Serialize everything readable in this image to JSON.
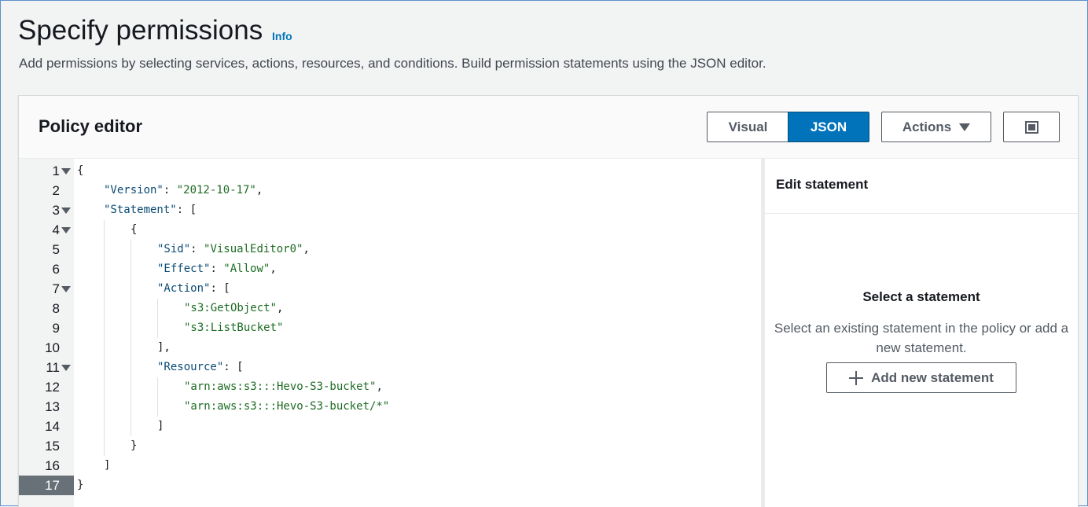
{
  "header": {
    "title": "Specify permissions",
    "info_label": "Info",
    "description": "Add permissions by selecting services, actions, resources, and conditions. Build permission statements using the JSON editor."
  },
  "policy_editor": {
    "title": "Policy editor",
    "mode_visual": "Visual",
    "mode_json": "JSON",
    "selected_mode": "JSON",
    "actions_label": "Actions",
    "icons": {
      "actions": "caret-down-icon",
      "fullscreen": "fullscreen-icon",
      "fold": "fold-triangle-icon"
    }
  },
  "editor": {
    "active_line": 17,
    "lines": [
      {
        "n": "1",
        "fold": true,
        "indent": 0,
        "tokens": [
          {
            "t": "p",
            "v": "{"
          }
        ]
      },
      {
        "n": "2",
        "fold": false,
        "indent": 1,
        "tokens": [
          {
            "t": "key",
            "v": "\"Version\""
          },
          {
            "t": "p",
            "v": ": "
          },
          {
            "t": "str",
            "v": "\"2012-10-17\""
          },
          {
            "t": "p",
            "v": ","
          }
        ]
      },
      {
        "n": "3",
        "fold": true,
        "indent": 1,
        "tokens": [
          {
            "t": "key",
            "v": "\"Statement\""
          },
          {
            "t": "p",
            "v": ": ["
          }
        ]
      },
      {
        "n": "4",
        "fold": true,
        "indent": 2,
        "tokens": [
          {
            "t": "p",
            "v": "{"
          }
        ]
      },
      {
        "n": "5",
        "fold": false,
        "indent": 3,
        "tokens": [
          {
            "t": "key",
            "v": "\"Sid\""
          },
          {
            "t": "p",
            "v": ": "
          },
          {
            "t": "str",
            "v": "\"VisualEditor0\""
          },
          {
            "t": "p",
            "v": ","
          }
        ]
      },
      {
        "n": "6",
        "fold": false,
        "indent": 3,
        "tokens": [
          {
            "t": "key",
            "v": "\"Effect\""
          },
          {
            "t": "p",
            "v": ": "
          },
          {
            "t": "str",
            "v": "\"Allow\""
          },
          {
            "t": "p",
            "v": ","
          }
        ]
      },
      {
        "n": "7",
        "fold": true,
        "indent": 3,
        "tokens": [
          {
            "t": "key",
            "v": "\"Action\""
          },
          {
            "t": "p",
            "v": ": ["
          }
        ]
      },
      {
        "n": "8",
        "fold": false,
        "indent": 4,
        "tokens": [
          {
            "t": "str",
            "v": "\"s3:GetObject\""
          },
          {
            "t": "p",
            "v": ","
          }
        ]
      },
      {
        "n": "9",
        "fold": false,
        "indent": 4,
        "tokens": [
          {
            "t": "str",
            "v": "\"s3:ListBucket\""
          }
        ]
      },
      {
        "n": "10",
        "fold": false,
        "indent": 3,
        "tokens": [
          {
            "t": "p",
            "v": "],"
          }
        ]
      },
      {
        "n": "11",
        "fold": true,
        "indent": 3,
        "tokens": [
          {
            "t": "key",
            "v": "\"Resource\""
          },
          {
            "t": "p",
            "v": ": ["
          }
        ]
      },
      {
        "n": "12",
        "fold": false,
        "indent": 4,
        "tokens": [
          {
            "t": "str",
            "v": "\"arn:aws:s3:::Hevo-S3-bucket\""
          },
          {
            "t": "p",
            "v": ","
          }
        ]
      },
      {
        "n": "13",
        "fold": false,
        "indent": 4,
        "tokens": [
          {
            "t": "str",
            "v": "\"arn:aws:s3:::Hevo-S3-bucket/*\""
          }
        ]
      },
      {
        "n": "14",
        "fold": false,
        "indent": 3,
        "tokens": [
          {
            "t": "p",
            "v": "]"
          }
        ]
      },
      {
        "n": "15",
        "fold": false,
        "indent": 2,
        "tokens": [
          {
            "t": "p",
            "v": "}"
          }
        ]
      },
      {
        "n": "16",
        "fold": false,
        "indent": 1,
        "tokens": [
          {
            "t": "p",
            "v": "]"
          }
        ]
      },
      {
        "n": "17",
        "fold": false,
        "indent": 0,
        "tokens": [
          {
            "t": "p",
            "v": "}"
          }
        ]
      }
    ]
  },
  "side_panel": {
    "title": "Edit statement",
    "empty_title": "Select a statement",
    "empty_description": "Select an existing statement in the policy or add a new statement.",
    "add_button_label": "Add new statement",
    "add_icon": "plus-icon"
  },
  "colors": {
    "accent": "#0073bb",
    "json_key": "#0a4a74",
    "json_string": "#1d6b22",
    "active_line_bg": "#687078"
  }
}
